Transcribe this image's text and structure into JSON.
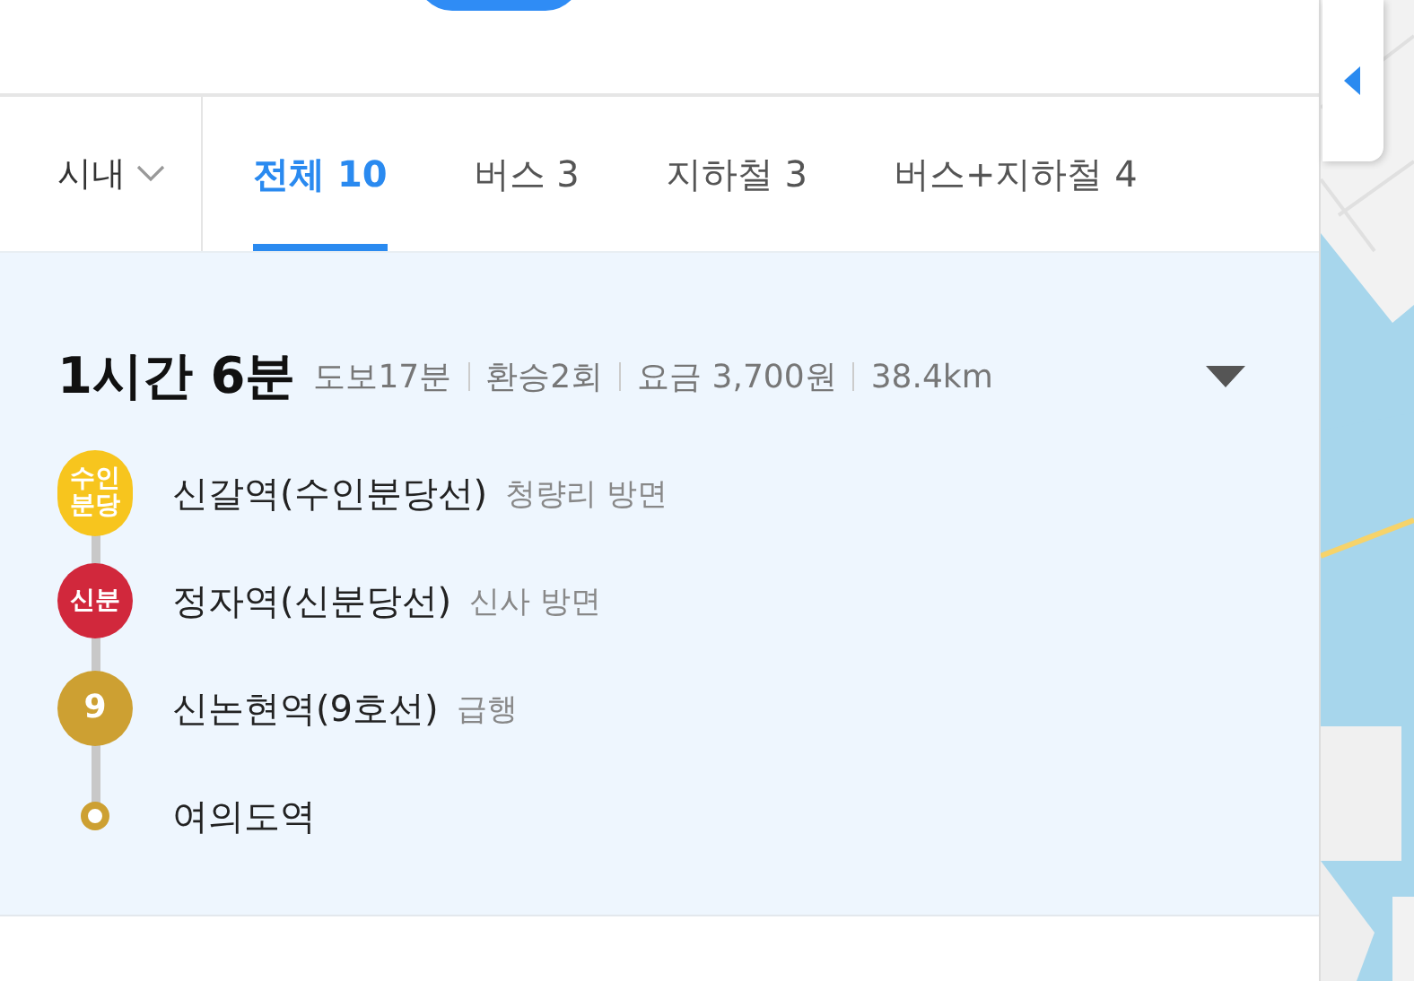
{
  "region_filter": {
    "label": "시내",
    "expanded": false
  },
  "tabs": [
    {
      "label": "전체 10",
      "selected": true
    },
    {
      "label": "버스 3",
      "selected": false
    },
    {
      "label": "지하철 3",
      "selected": false
    },
    {
      "label": "버스+지하철 4",
      "selected": false
    }
  ],
  "route": {
    "total_time": "1시간 6분",
    "details": [
      "도보17분",
      "환승2회",
      "요금 3,700원",
      "38.4km"
    ],
    "expanded": false,
    "steps": [
      {
        "kind": "line",
        "badge": "수인분당",
        "color": "#f7c51e",
        "station": "신갈역(수인분당선)",
        "note": "청량리 방면"
      },
      {
        "kind": "line",
        "badge": "신분",
        "color": "#d1283c",
        "station": "정자역(신분당선)",
        "note": "신사 방면"
      },
      {
        "kind": "line",
        "badge": "9",
        "color": "#cda032",
        "station": "신논현역(9호선)",
        "note": "급행"
      },
      {
        "kind": "end",
        "color": "#cda032",
        "station": "여의도역"
      }
    ]
  }
}
